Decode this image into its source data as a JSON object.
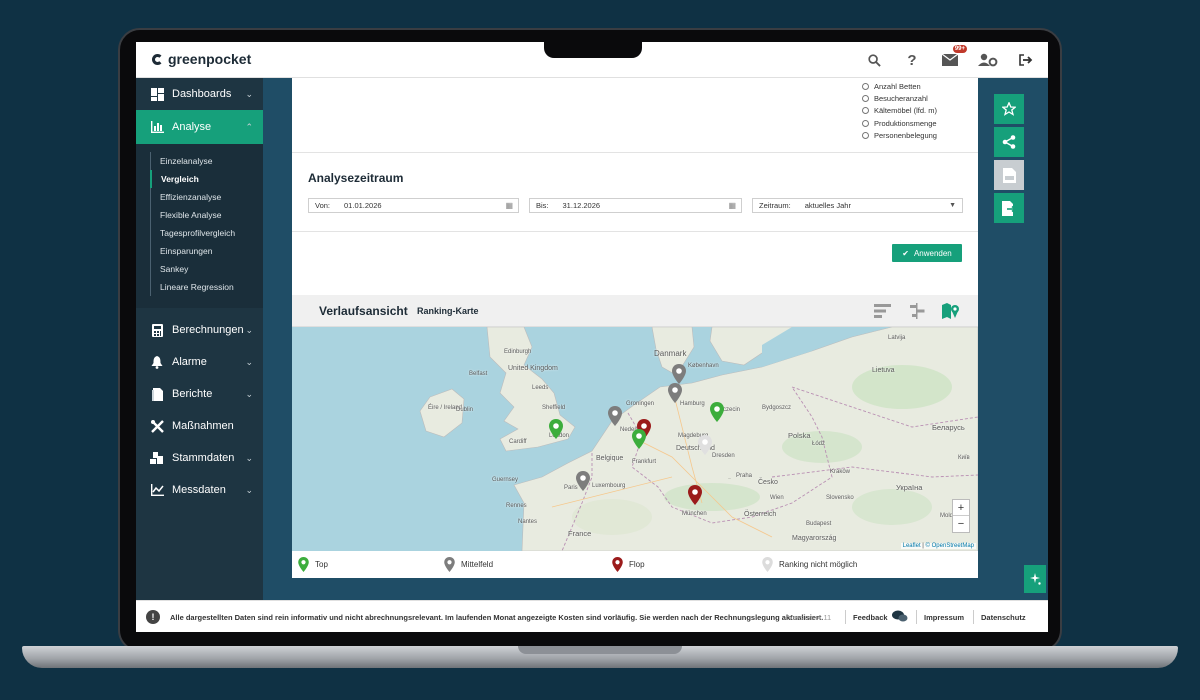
{
  "app": {
    "logo_text": "greenpocket",
    "notification_count": "99+"
  },
  "sidebar": {
    "items": [
      {
        "label": "Dashboards",
        "icon": "dashboard-icon"
      },
      {
        "label": "Analyse",
        "icon": "bar-chart-icon"
      },
      {
        "label": "Berechnungen",
        "icon": "calculator-icon"
      },
      {
        "label": "Alarme",
        "icon": "bell-icon"
      },
      {
        "label": "Berichte",
        "icon": "document-icon"
      },
      {
        "label": "Maßnahmen",
        "icon": "tools-icon"
      },
      {
        "label": "Stammdaten",
        "icon": "master-data-icon"
      },
      {
        "label": "Messdaten",
        "icon": "meter-data-icon"
      }
    ],
    "analyse_subitems": [
      "Einzelanalyse",
      "Vergleich",
      "Effizienzanalyse",
      "Flexible Analyse",
      "Tagesprofilvergleich",
      "Einsparungen",
      "Sankey",
      "Lineare Regression"
    ],
    "active_subitem": "Vergleich"
  },
  "reference_options": [
    "Anzahl Betten",
    "Besucheranzahl",
    "Kältemöbel (lfd. m)",
    "Produktionsmenge",
    "Personenbelegung"
  ],
  "zeitraum": {
    "title": "Analysezeitraum",
    "von_label": "Von:",
    "von_value": "01.01.2026",
    "bis_label": "Bis:",
    "bis_value": "31.12.2026",
    "zeitraum_label": "Zeitraum:",
    "zeitraum_value": "aktuelles Jahr",
    "apply_label": "Anwenden"
  },
  "map_panel": {
    "title": "Verlaufsansicht",
    "subtitle": "Ranking-Karte",
    "labels": [
      "Danmark",
      "Edinburgh",
      "United Kingdom",
      "Belfast",
      "Éire / Ireland",
      "Dublin",
      "Sheffield",
      "Cardiff",
      "London",
      "Leeds",
      "København",
      "Hamburg",
      "Groningen",
      "Nederland",
      "Szczecin",
      "Bydgoszcz",
      "Polska",
      "Deutschland",
      "Magdeburg",
      "Dresden",
      "Łódź",
      "Praha",
      "Česko",
      "Kraków",
      "Belgique",
      "Luxembourg",
      "Frankfurt",
      "Guernsey",
      "Rennes",
      "Paris",
      "Nantes",
      "France",
      "München",
      "Österreich",
      "Wien",
      "Slovensko",
      "Budapest",
      "Magyarország",
      "Latvija",
      "Lietuva",
      "Беларусь",
      "Україна",
      "Київ",
      "Moldova",
      "Ceska"
    ],
    "legend": {
      "top": "Top",
      "mid": "Mittelfeld",
      "flop": "Flop",
      "none": "Ranking nicht möglich"
    },
    "attribution_a": "Leaflet",
    "attribution_b": "© OpenStreetMap",
    "zoom_in": "+",
    "zoom_out": "−"
  },
  "footer": {
    "notice": "Alle dargestellten Daten sind rein informativ und nicht abrechnungsrelevant. Im laufenden Monat angezeigte Kosten sind vorläufig. Sie werden nach der Rechnungslegung aktualisiert.",
    "version": "Version: 4.11",
    "feedback": "Feedback",
    "impressum": "Impressum",
    "datenschutz": "Datenschutz"
  },
  "colors": {
    "accent": "#16a07b",
    "top": "#3cad3c",
    "mid": "#7d7d7d",
    "flop": "#9b1b1b",
    "none": "#e0e0e0"
  }
}
